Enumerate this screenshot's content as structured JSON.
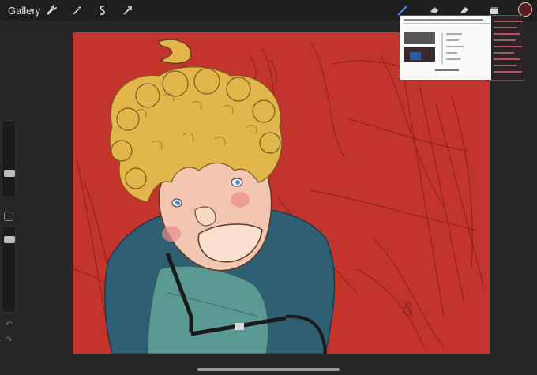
{
  "topbar": {
    "gallery_label": "Gallery",
    "left_tools": [
      "wrench-icon",
      "magic-wand-icon",
      "selection-icon",
      "transform-arrow-icon"
    ],
    "right_tools": [
      "brush-icon",
      "smudge-icon",
      "eraser-icon",
      "layers-icon"
    ],
    "current_color": "#5a1a1a"
  },
  "colors": {
    "canvas_bg": "#c2342c",
    "ui_bg": "#262626",
    "hair": "#e2b64a",
    "hoodie": "#2e5f73",
    "shirt": "#5a9a92",
    "skin": "#f2c6b0"
  }
}
